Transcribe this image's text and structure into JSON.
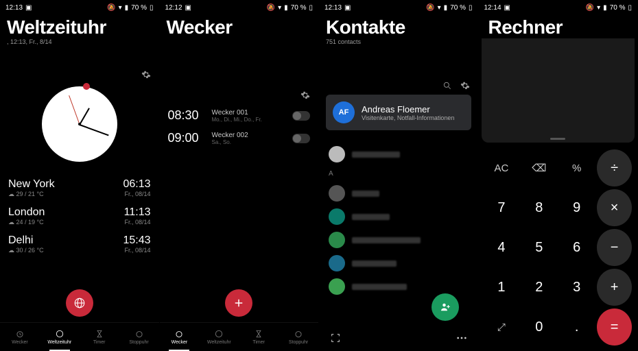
{
  "status": {
    "time1": "12:13",
    "time2": "12:12",
    "time3": "12:13",
    "time4": "12:14",
    "battery": "70 %"
  },
  "screen1": {
    "title": "Weltzeituhr",
    "subtitle": ", 12:13, Fr., 8/14",
    "cities": [
      {
        "name": "New York",
        "temp": "☁ 29 / 21 °C",
        "time": "06:13",
        "date": "Fr., 08/14"
      },
      {
        "name": "London",
        "temp": "☁ 24 / 19 °C",
        "time": "11:13",
        "date": "Fr., 08/14"
      },
      {
        "name": "Delhi",
        "temp": "☁ 30 / 26 °C",
        "time": "15:43",
        "date": "Fr., 08/14"
      }
    ],
    "tabs": [
      "Wecker",
      "Weltzeituhr",
      "Timer",
      "Stoppuhr"
    ]
  },
  "screen2": {
    "title": "Wecker",
    "alarms": [
      {
        "time": "08:30",
        "label": "Wecker 001",
        "days": "Mo., Di., Mi., Do., Fr."
      },
      {
        "time": "09:00",
        "label": "Wecker 002",
        "days": "Sa., So."
      }
    ],
    "tabs": [
      "Wecker",
      "Weltzeituhr",
      "Timer",
      "Stoppuhr"
    ]
  },
  "screen3": {
    "title": "Kontakte",
    "subtitle": "751 contacts",
    "profile": {
      "initials": "AF",
      "name": "Andreas Floemer",
      "sub": "Visitenkarte, Notfall-Informationen"
    },
    "section": "A"
  },
  "screen4": {
    "title": "Rechner",
    "keys": {
      "ac": "AC",
      "del": "⌫",
      "pct": "%",
      "div": "÷",
      "k7": "7",
      "k8": "8",
      "k9": "9",
      "mul": "×",
      "k4": "4",
      "k5": "5",
      "k6": "6",
      "sub": "−",
      "k1": "1",
      "k2": "2",
      "k3": "3",
      "add": "+",
      "exp": "⤢",
      "k0": "0",
      "dot": ".",
      "eq": "="
    }
  }
}
